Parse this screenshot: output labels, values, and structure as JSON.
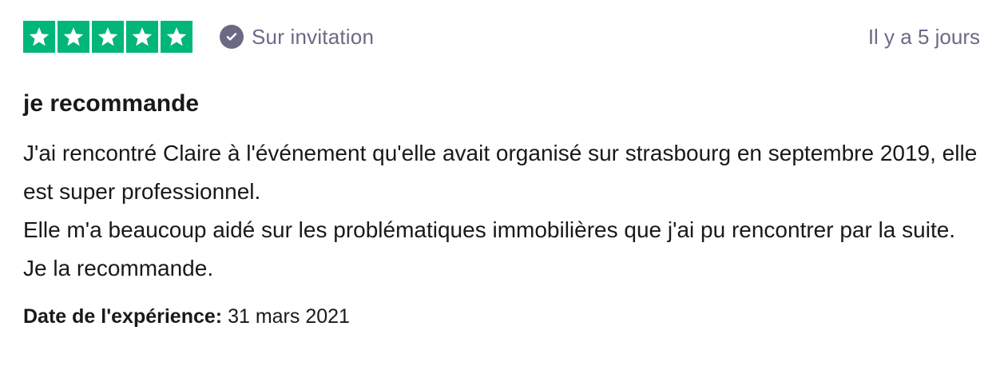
{
  "rating": {
    "stars_filled": 5,
    "stars_total": 5,
    "star_color": "#00b67a"
  },
  "verification": {
    "icon": "check-circle-icon",
    "label": "Sur invitation",
    "color": "#6a6a85"
  },
  "review": {
    "date_ago": "Il y a 5 jours",
    "title": "je recommande",
    "body": [
      "J'ai rencontré Claire à l'événement qu'elle avait organisé sur strasbourg en septembre 2019, elle est super professionnel.",
      "Elle m'a beaucoup aidé sur les problématiques immobilières que j'ai pu rencontrer par la suite.",
      "Je la recommande."
    ],
    "experience_label": "Date de l'expérience:",
    "experience_date": "31 mars 2021"
  }
}
